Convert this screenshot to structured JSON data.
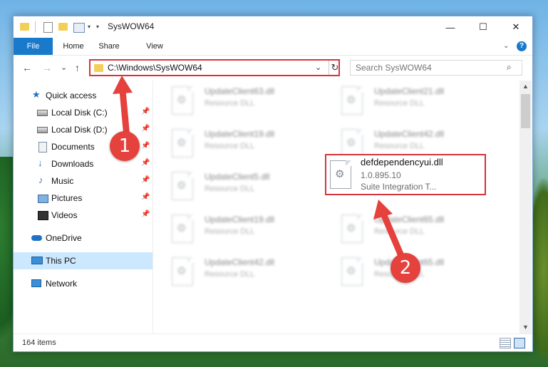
{
  "window": {
    "title": "SysWOW64",
    "controls": {
      "minimize": "—",
      "maximize": "☐",
      "close": "✕"
    }
  },
  "ribbon": {
    "tabs": [
      "File",
      "Home",
      "Share",
      "View"
    ],
    "help": "?"
  },
  "nav": {
    "back": "←",
    "forward": "→",
    "recent": "⌄",
    "up": "↑",
    "address": "C:\\Windows\\SysWOW64",
    "address_dropdown": "⌄",
    "refresh": "↻",
    "search_placeholder": "Search SysWOW64",
    "search_icon": "⌕"
  },
  "sidebar": {
    "pin_glyph": "📌",
    "items": [
      {
        "label": "Quick access",
        "icon": "star-icon",
        "pinned": false
      },
      {
        "label": "Local Disk (C:)",
        "icon": "drive-icon",
        "pinned": true
      },
      {
        "label": "Local Disk (D:)",
        "icon": "drive-icon",
        "pinned": true
      },
      {
        "label": "Documents",
        "icon": "documents-icon",
        "pinned": true
      },
      {
        "label": "Downloads",
        "icon": "download-icon",
        "pinned": true
      },
      {
        "label": "Music",
        "icon": "music-icon",
        "pinned": true
      },
      {
        "label": "Pictures",
        "icon": "pictures-icon",
        "pinned": true
      },
      {
        "label": "Videos",
        "icon": "videos-icon",
        "pinned": true
      },
      {
        "label": "OneDrive",
        "icon": "onedrive-icon",
        "pinned": false
      },
      {
        "label": "This PC",
        "icon": "computer-icon",
        "pinned": false,
        "selected": true
      },
      {
        "label": "Network",
        "icon": "network-icon",
        "pinned": false
      }
    ]
  },
  "files": [
    {
      "name": "UpdateClient63.dll",
      "type": "Resource DLL"
    },
    {
      "name": "UpdateClient21.dll",
      "type": "Resource DLL"
    },
    {
      "name": "UpdateClient19.dll",
      "type": "Resource DLL"
    },
    {
      "name": "UpdateClient42.dll",
      "type": "Resource DLL"
    },
    {
      "name": "UpdateClient5.dll",
      "type": "Resource DLL"
    },
    {
      "name": "UpdateClient19.dll",
      "type": "Resource DLL"
    },
    {
      "name": "UpdateClient65.dll",
      "type": "Resource DLL"
    },
    {
      "name": "UpdateClient42.dll",
      "type": "Resource DLL"
    },
    {
      "name": "UpdateClient65.dll",
      "type": "Resource DLL"
    }
  ],
  "highlighted_file": {
    "name": "defdependencyui.dll",
    "version": "1.0.895.10",
    "description": "Suite Integration T..."
  },
  "scrollbar": {
    "up": "▲",
    "down": "▼"
  },
  "status": {
    "item_count": "164 items"
  },
  "annotations": [
    {
      "number": "1",
      "color": "#e5413d"
    },
    {
      "number": "2",
      "color": "#e5413d"
    }
  ],
  "colors": {
    "accent": "#1979ca",
    "highlight": "#d6343c",
    "selection": "#cce8ff"
  }
}
